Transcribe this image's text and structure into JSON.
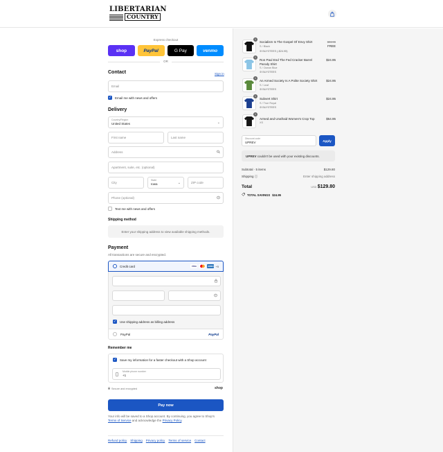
{
  "header": {
    "logo_line1": "LIBERTARIAN",
    "logo_line2": "COUNTRY",
    "cart_icon": "shopping-bag-icon"
  },
  "express": {
    "label": "Express checkout",
    "shop": "shop",
    "paypal": "PayPal",
    "gpay": "G Pay",
    "venmo": "venmo",
    "or": "OR"
  },
  "contact": {
    "title": "Contact",
    "signin": "Sign in",
    "email_placeholder": "Email",
    "email_news": "Email me with news and offers"
  },
  "delivery": {
    "title": "Delivery",
    "country_label": "Country/Region",
    "country_value": "United States",
    "first_name": "First name",
    "last_name": "Last name",
    "address": "Address",
    "apartment": "Apartment, suite, etc. (optional)",
    "city": "City",
    "state_label": "State",
    "state_value": "Iowa",
    "zip": "ZIP code",
    "phone": "Phone (optional)",
    "text_news": "Text me with news and offers"
  },
  "shipping_method": {
    "title": "Shipping method",
    "info": "Enter your shipping address to view available shipping methods."
  },
  "payment": {
    "title": "Payment",
    "subtitle": "All transactions are secure and encrypted.",
    "credit_card": "Credit card",
    "card_visa": "VISA",
    "card_amex": "AMEX",
    "card_more": "+5",
    "billing": "Use shipping address as billing address",
    "paypal": "PayPal",
    "paypal_logo": "PayPal"
  },
  "remember": {
    "title": "Remember me",
    "save_info": "Save my information for a faster checkout with a Shop account",
    "phone_label": "Mobile phone number",
    "phone_value": "+1",
    "secure": "Secure and encrypted",
    "shop": "shop"
  },
  "pay_now": "Pay now",
  "legal": {
    "text1": "Your info will be saved to a Shop account. By continuing, you agree to Shop's",
    "terms": "Terms of Service",
    "text2": "and acknowledge the",
    "privacy": "Privacy Policy",
    "period": "."
  },
  "footer": {
    "links": [
      "Refund policy",
      "Shipping",
      "Privacy policy",
      "Terms of service",
      "Contact"
    ]
  },
  "items": [
    {
      "name": "Socialism Is The Gospel Of Envy Shirt",
      "variant": "S / Black",
      "badge": "BUY3TEES (-$24.95)",
      "price_old": "$24.95",
      "price": "FREE",
      "qty": "1",
      "color": "#111111"
    },
    {
      "name": "Ron Paul End The Fed Cracker Barrel Parody Shirt",
      "variant": "S / Ocean Blue",
      "badge": "BUY3TEES",
      "price_old": "",
      "price": "$24.95",
      "qty": "1",
      "color": "#8cc5e6"
    },
    {
      "name": "An Armed Society Is A Polite Society Shirt",
      "variant": "S / Leaf",
      "badge": "BUY3TEES",
      "price_old": "",
      "price": "$24.95",
      "qty": "1",
      "color": "#5a8a3c"
    },
    {
      "name": "Subvert Shirt",
      "variant": "S / True Royal",
      "badge": "BUY3TEES",
      "price_old": "",
      "price": "$24.95",
      "qty": "1",
      "color": "#1c3f8f"
    },
    {
      "name": "Armed and Unafraid Women's Crop Top",
      "variant": "XS",
      "badge": "",
      "price_old": "",
      "price": "$54.95",
      "qty": "1",
      "color": "#161616"
    }
  ],
  "discount": {
    "label": "Discount code",
    "value": "UPREV",
    "apply": "Apply",
    "msg_code": "UPREV",
    "msg_text": "couldn't be used with your existing discounts."
  },
  "summary": {
    "subtotal_label": "Subtotal · 5 items",
    "subtotal_value": "$129.80",
    "shipping_label": "Shipping",
    "shipping_value": "Enter shipping address",
    "total_label": "Total",
    "currency": "USD",
    "total_value": "$129.80",
    "savings_label": "TOTAL SAVINGS",
    "savings_value": "$24.95"
  }
}
